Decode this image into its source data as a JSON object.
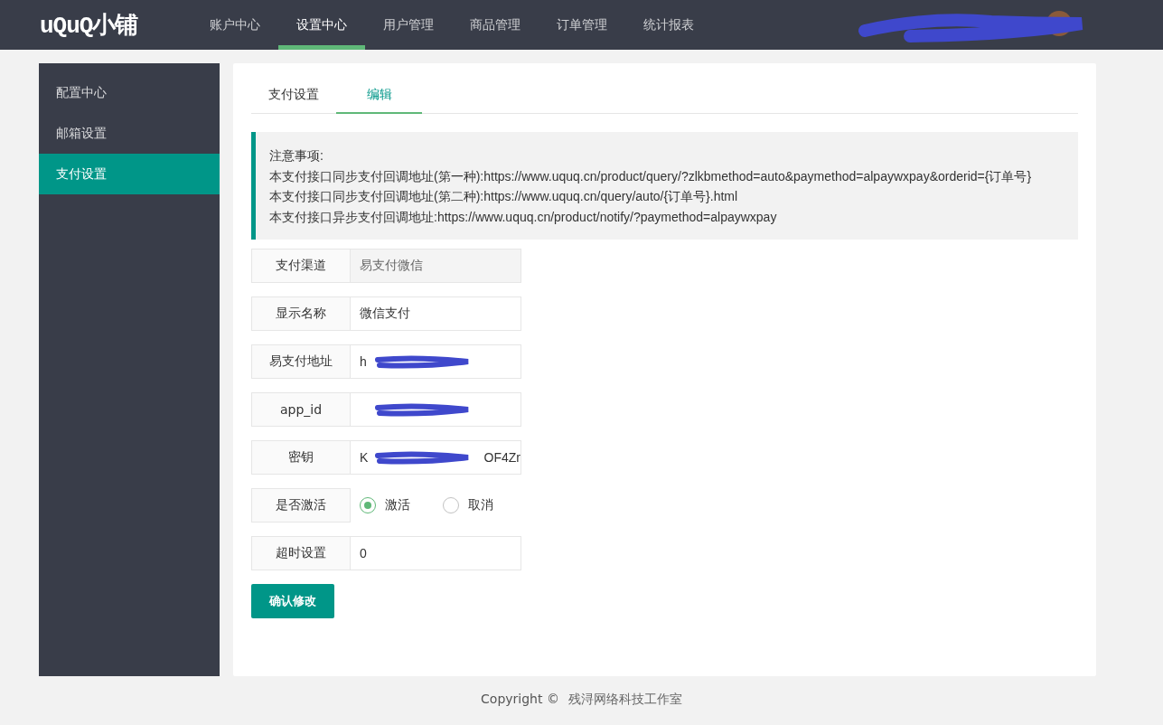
{
  "header": {
    "logo": "uQuQ小铺",
    "nav": [
      {
        "label": "账户中心",
        "selected": false
      },
      {
        "label": "设置中心",
        "selected": true
      },
      {
        "label": "用户管理",
        "selected": false
      },
      {
        "label": "商品管理",
        "selected": false
      },
      {
        "label": "订单管理",
        "selected": false
      },
      {
        "label": "统计报表",
        "selected": false
      }
    ],
    "user": {
      "redacted": true
    }
  },
  "sidebar": {
    "items": [
      {
        "label": "配置中心",
        "selected": false
      },
      {
        "label": "邮箱设置",
        "selected": false
      },
      {
        "label": "支付设置",
        "selected": true
      }
    ]
  },
  "tabs": [
    {
      "label": "支付设置",
      "selected": false
    },
    {
      "label": "编辑",
      "selected": true
    }
  ],
  "notice": {
    "title": "注意事项:",
    "lines": [
      "本支付接口同步支付回调地址(第一种):https://www.uquq.cn/product/query/?zlkbmethod=auto&paymethod=alpaywxpay&orderid={订单号}",
      "本支付接口同步支付回调地址(第二种):https://www.uquq.cn/query/auto/{订单号}.html",
      "本支付接口异步支付回调地址:https://www.uquq.cn/product/notify/?paymethod=alpaywxpay"
    ]
  },
  "form": [
    {
      "kind": "text",
      "label": "支付渠道",
      "value": "易支付微信",
      "disabled": true,
      "redacted": false
    },
    {
      "kind": "text",
      "label": "显示名称",
      "value": "微信支付",
      "disabled": false,
      "redacted": false
    },
    {
      "kind": "text",
      "label": "易支付地址",
      "value": "h",
      "disabled": false,
      "redacted": true
    },
    {
      "kind": "text",
      "label": "app_id",
      "disabled": false,
      "redacted": true
    },
    {
      "kind": "text",
      "label": "密钥",
      "value": "K",
      "value_end": "OF4Zr",
      "disabled": false,
      "redacted": true
    },
    {
      "kind": "radio",
      "label": "是否激活",
      "options": [
        {
          "label": "激活",
          "selected": true
        },
        {
          "label": "取消",
          "selected": false
        }
      ]
    },
    {
      "kind": "text",
      "label": "超时设置",
      "value": "0",
      "disabled": false,
      "redacted": false
    }
  ],
  "submit": "确认修改",
  "footer": {
    "copyright": "Copyright ©",
    "company": "残浔网络科技工作室"
  }
}
